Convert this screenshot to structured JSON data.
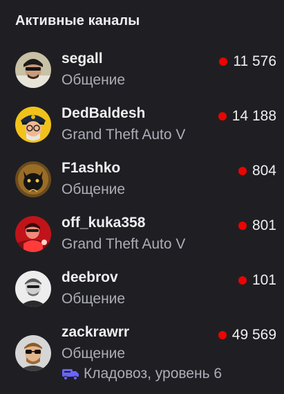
{
  "section": {
    "title": "Активные каналы"
  },
  "channels": [
    {
      "name": "segall",
      "category": "Общение",
      "viewers": "11 576",
      "avatar_icon": "segall-avatar"
    },
    {
      "name": "DedBaldesh",
      "category": "Grand Theft Auto V",
      "viewers": "14 188",
      "avatar_icon": "dedbaldesh-avatar"
    },
    {
      "name": "F1ashko",
      "category": "Общение",
      "viewers": "804",
      "avatar_icon": "f1ashko-avatar"
    },
    {
      "name": "off_kuka358",
      "category": "Grand Theft Auto V",
      "viewers": "801",
      "avatar_icon": "off-kuka358-avatar"
    },
    {
      "name": "deebrov",
      "category": "Общение",
      "viewers": "101",
      "avatar_icon": "deebrov-avatar"
    },
    {
      "name": "zackrawrr",
      "category": "Общение",
      "viewers": "49 569",
      "avatar_icon": "zackrawrr-avatar",
      "badge": {
        "icon": "truck-icon",
        "text": "Кладовоз, уровень 6"
      }
    }
  ],
  "colors": {
    "live": "#eb0400",
    "background": "#1f1f23",
    "secondary_text": "#adadb8",
    "badge": "#6b64ff"
  }
}
